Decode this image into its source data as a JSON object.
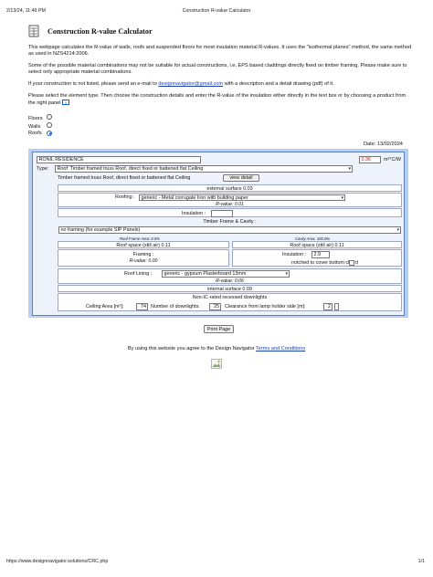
{
  "print_header": {
    "datetime": "2/13/24, 11:49 PM",
    "doc_title": "Construction R-value Calculator"
  },
  "title": "Construction R-value Calculator",
  "intro": {
    "p1": "This webpage calculates the R-value of walls, roofs and suspended floors for most insulation material R-values. It uses the \"isothermal planes\" method, the same method as used in NZS4214:2006.",
    "p2": "Some of the possible material combinations may not be suitable for actual constructions, i.e. EPS based claddings directly fixed on timber framing. Please make sure to select only appropriate material combinations.",
    "p3_before": "If your construction is not listed, please send an e-mail to ",
    "p3_email": "designnavigator@gmail.com",
    "p3_after": " with a description and a detail drawing (pdf) of it.",
    "p4": "Please select the element type. Then choose the construction details and enter the R-value of the insulation either directly in the text box or by choosing a product from the right panel"
  },
  "element_types": [
    {
      "label": "Floors",
      "selected": false
    },
    {
      "label": "Walls",
      "selected": false
    },
    {
      "label": "Roofs",
      "selected": true
    }
  ],
  "date_label": "Date: 13/02/2024",
  "calc": {
    "project_name": "RONIL RESIDENCE",
    "result_value": "0.36",
    "result_unit": "m²°C/W",
    "type_label": "Type:",
    "type_value": "Roof: Timber framed truss Roof, direct fixed or battened flat Ceiling",
    "type_desc": "Timber framed truss Roof, direct fixed or battened flat Ceiling",
    "view_detail": "view detail",
    "external_surface": "external surface 0.03",
    "roofing_label": "Roofing :",
    "roofing_value": "generic - Metal corrugate Iron with building paper",
    "roofing_rvalue": "R-value: 0.01",
    "insulation_label": "Insulation :",
    "insulation_value": "",
    "frame_title": "Timber Frame & Cavity :",
    "frame_value": "no framing (for example SIP Panels)",
    "left_frame_area": "Roof Frame Area: 0.0%",
    "right_cavity_area": "Cavity Area: 100.0%",
    "left_roof_space": "Roof space (still air) 0.11",
    "right_roof_space": "Roof space (still air) 0.11",
    "framing_label": "Framing :",
    "framing_rvalue": "R-value: 0.00",
    "right_insulation_label": "Insulation :",
    "right_insulation_value": "2.9",
    "notched_label": "notched to cover bottom chord",
    "lining_label": "Roof Lining :",
    "lining_value": "generic - gypsum Plasterboard 13mm",
    "lining_rvalue": "R-value: 0.06",
    "internal_surface": "internal surface 0.09",
    "downlights_title": "Non-IC-rated recessed downlights",
    "ceiling_area_label": "Ceiling Area [m²]:",
    "ceiling_area_value": "74",
    "num_downlights_label": "Number of downlights:",
    "num_downlights_value": "25",
    "clearance_label": "Clearance from lamp holder side [m]:",
    "clearance_value": "2"
  },
  "print_button": "Print Page",
  "terms": {
    "before": "By using this website you agree to the Design Navigator ",
    "link": "Terms and Conditions"
  },
  "print_footer": {
    "url": "https://www.designnavigator.solutions/CRC.php",
    "page": "1/1"
  },
  "colors": {
    "panel_bg": "#b8cff2",
    "inner_bg": "#eef2fb",
    "result_red": "#cc1111",
    "link_blue": "#1a3fb0"
  }
}
